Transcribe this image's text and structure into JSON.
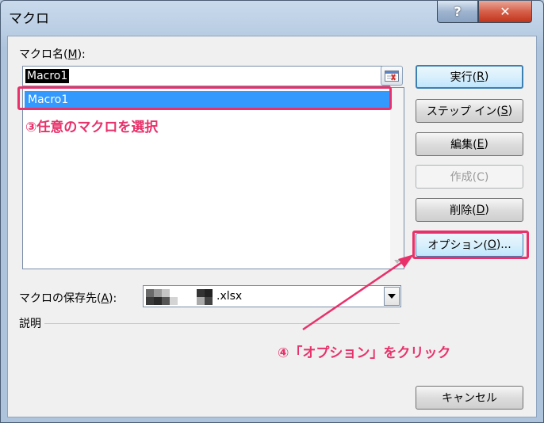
{
  "window": {
    "title": "マクロ"
  },
  "title_buttons": {
    "help": "?",
    "close": "✕"
  },
  "macro_name": {
    "label_pre": "マクロ名(",
    "label_key": "M",
    "label_post": "):",
    "input_value": "Macro1",
    "list_items": [
      "Macro1"
    ]
  },
  "buttons": {
    "run": {
      "pre": "実行(",
      "key": "R",
      "post": ")"
    },
    "step_in": {
      "pre": "ステップ イン(",
      "key": "S",
      "post": ")"
    },
    "edit": {
      "pre": "編集(",
      "key": "E",
      "post": ")"
    },
    "create": {
      "label": "作成(C)"
    },
    "delete": {
      "pre": "削除(",
      "key": "D",
      "post": ")"
    },
    "options": {
      "pre": "オプション(",
      "key": "O",
      "post": ")..."
    },
    "cancel": {
      "label": "キャンセル"
    }
  },
  "location": {
    "label_pre": "マクロの保存先(",
    "label_key": "A",
    "label_post": "):",
    "value": ".xlsx"
  },
  "description": {
    "label": "説明"
  },
  "annotations": {
    "step3": "③任意のマクロを選択",
    "step4": "④「オプション」をクリック"
  },
  "colors": {
    "annotation": "#e8316b",
    "selection": "#3399ff"
  }
}
